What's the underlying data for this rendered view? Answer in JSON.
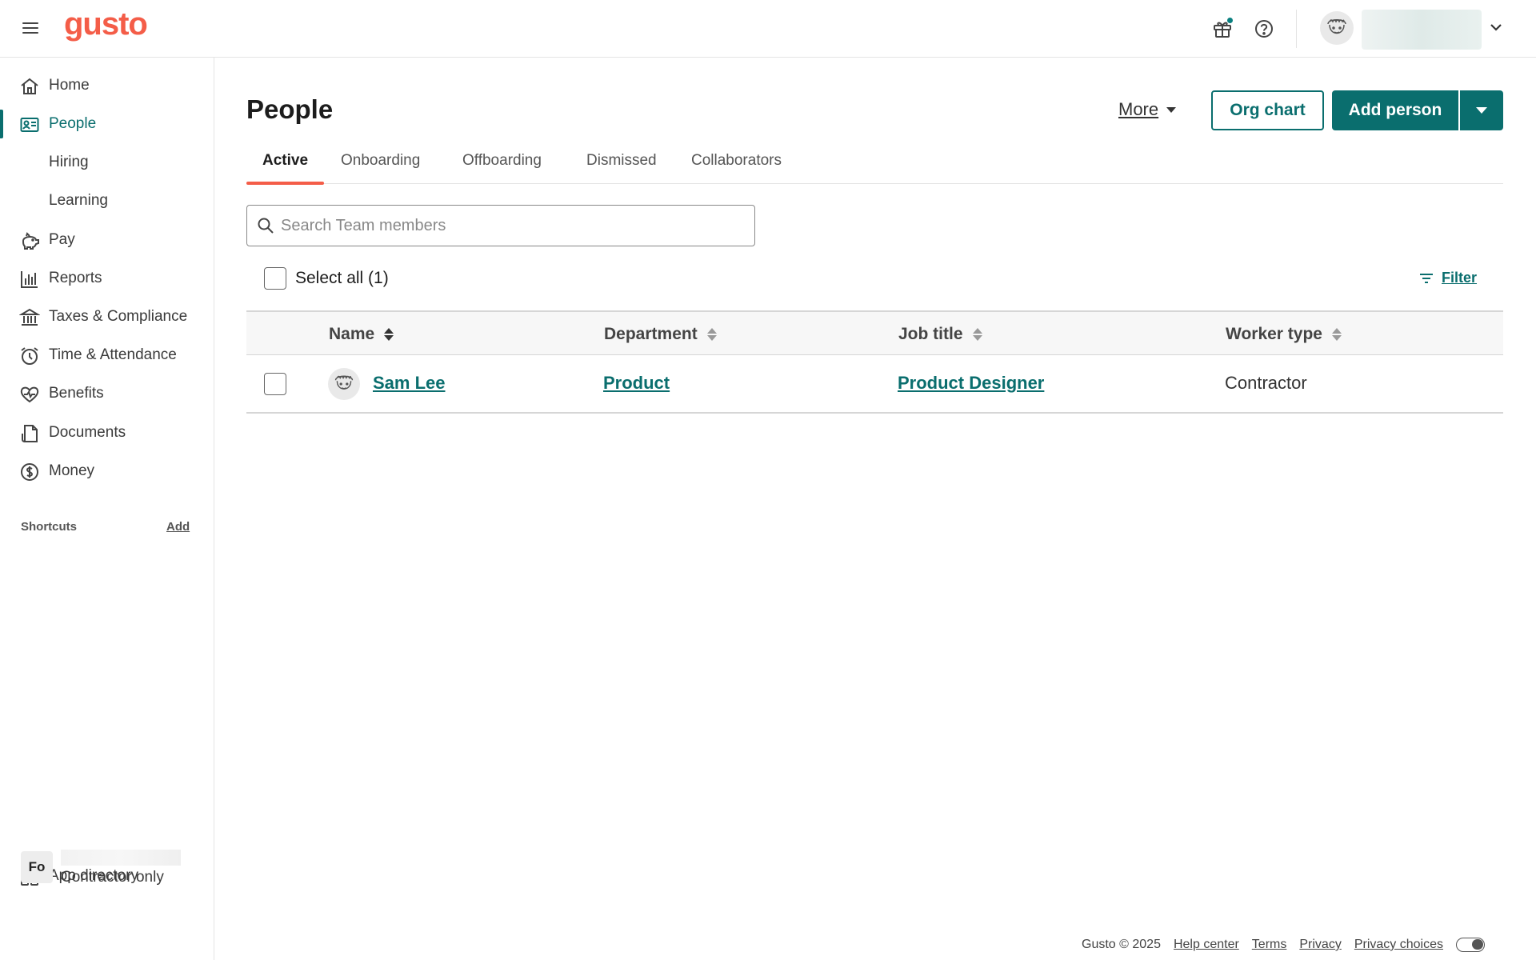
{
  "brand": {
    "logo_text": "gusto",
    "accent": "#f45d48",
    "primary": "#0a6e6e"
  },
  "topbar": {
    "icons": [
      "hamburger-menu-icon",
      "gift-icon",
      "help-icon",
      "user-avatar",
      "chevron-down-icon"
    ]
  },
  "sidebar": {
    "items": [
      {
        "label": "Home",
        "icon": "home-icon"
      },
      {
        "label": "People",
        "icon": "people-card-icon",
        "active": true
      },
      {
        "label": "Hiring"
      },
      {
        "label": "Learning"
      },
      {
        "label": "Pay",
        "icon": "piggy-bank-icon"
      },
      {
        "label": "Reports",
        "icon": "bar-chart-icon"
      },
      {
        "label": "Taxes & Compliance",
        "icon": "bank-icon"
      },
      {
        "label": "Time & Attendance",
        "icon": "alarm-clock-icon"
      },
      {
        "label": "Benefits",
        "icon": "heart-pulse-icon"
      },
      {
        "label": "Documents",
        "icon": "document-icon"
      },
      {
        "label": "Money",
        "icon": "dollar-circle-icon"
      }
    ],
    "shortcuts_label": "Shortcuts",
    "shortcuts_add": "Add",
    "app_directory": "App directory",
    "company_initials": "Fo",
    "company_subtitle": "Contractor only"
  },
  "main": {
    "title": "People",
    "more_label": "More",
    "org_chart_label": "Org chart",
    "add_person_label": "Add person",
    "tabs": [
      {
        "label": "Active",
        "active": true
      },
      {
        "label": "Onboarding"
      },
      {
        "label": "Offboarding"
      },
      {
        "label": "Dismissed"
      },
      {
        "label": "Collaborators"
      }
    ],
    "search_placeholder": "Search Team members",
    "select_all_label": "Select all (1)",
    "filter_label": "Filter",
    "table": {
      "columns": [
        "Name",
        "Department",
        "Job title",
        "Worker type"
      ],
      "rows": [
        {
          "name": "Sam Lee",
          "department": "Product",
          "job_title": "Product Designer",
          "worker_type": "Contractor"
        }
      ]
    }
  },
  "footer": {
    "copyright": "Gusto © 2025",
    "links": [
      "Help center",
      "Terms",
      "Privacy",
      "Privacy choices"
    ]
  }
}
